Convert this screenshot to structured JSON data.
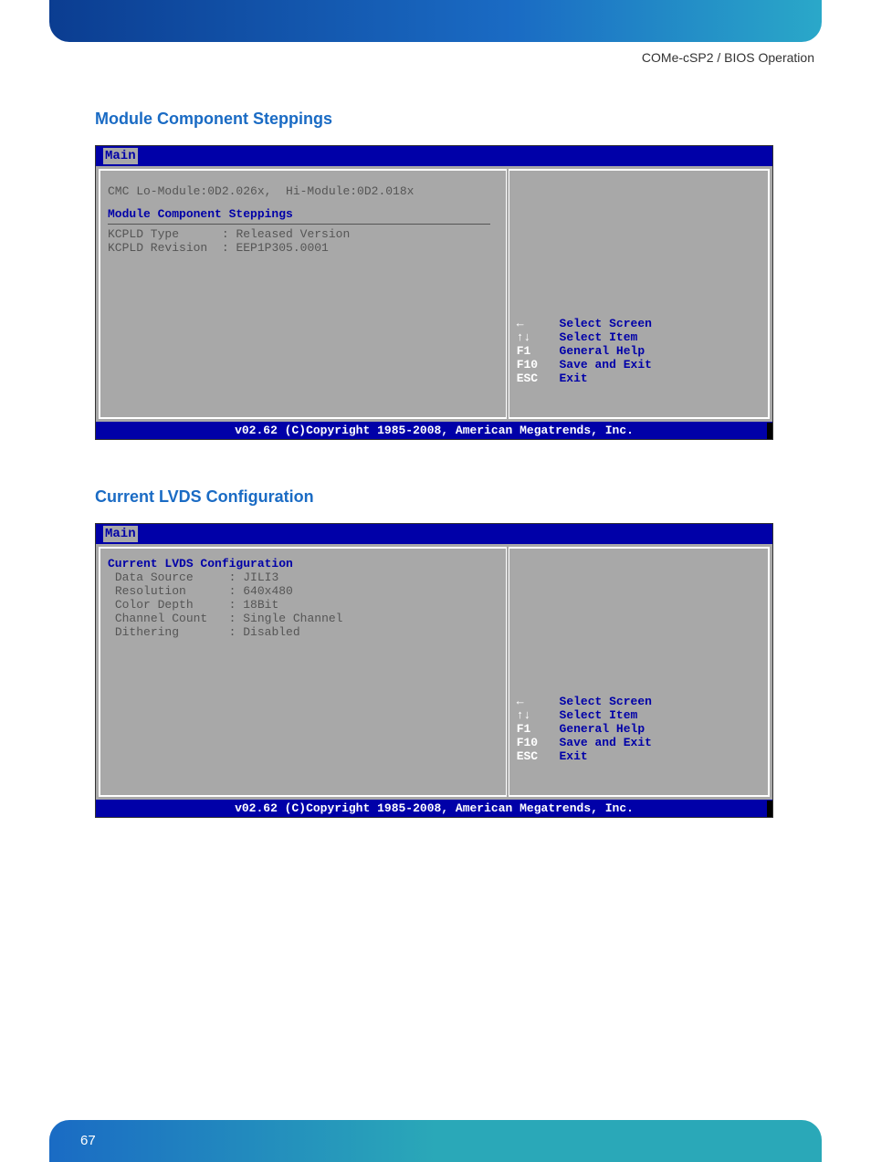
{
  "header": {
    "breadcrumb": "COMe-cSP2 / BIOS Operation"
  },
  "section1": {
    "title": "Module Component Steppings",
    "bios": {
      "tab": "Main",
      "cmc_line": "CMC Lo-Module:0D2.026x,  Hi-Module:0D2.018x",
      "heading": "Module Component Steppings",
      "rows": [
        {
          "label": "KCPLD Type",
          "value": "Released Version"
        },
        {
          "label": "KCPLD Revision",
          "value": "EEP1P305.0001"
        }
      ],
      "nav": [
        {
          "key": "←",
          "label": "Select Screen"
        },
        {
          "key": "↑↓",
          "label": "Select Item"
        },
        {
          "key": "F1",
          "label": "General Help"
        },
        {
          "key": "F10",
          "label": "Save and Exit"
        },
        {
          "key": "ESC",
          "label": "Exit"
        }
      ],
      "footer": "v02.62 (C)Copyright 1985-2008, American Megatrends, Inc."
    }
  },
  "section2": {
    "title": "Current LVDS Configuration",
    "bios": {
      "tab": "Main",
      "heading": "Current LVDS Configuration",
      "rows": [
        {
          "label": "Data Source",
          "value": "JILI3"
        },
        {
          "label": "Resolution",
          "value": "640x480"
        },
        {
          "label": "Color Depth",
          "value": "18Bit"
        },
        {
          "label": "Channel Count",
          "value": "Single Channel"
        },
        {
          "label": "Dithering",
          "value": "Disabled"
        }
      ],
      "nav": [
        {
          "key": "←",
          "label": "Select Screen"
        },
        {
          "key": "↑↓",
          "label": "Select Item"
        },
        {
          "key": "F1",
          "label": "General Help"
        },
        {
          "key": "F10",
          "label": "Save and Exit"
        },
        {
          "key": "ESC",
          "label": "Exit"
        }
      ],
      "footer": "v02.62 (C)Copyright 1985-2008, American Megatrends, Inc."
    }
  },
  "page_number": "67"
}
